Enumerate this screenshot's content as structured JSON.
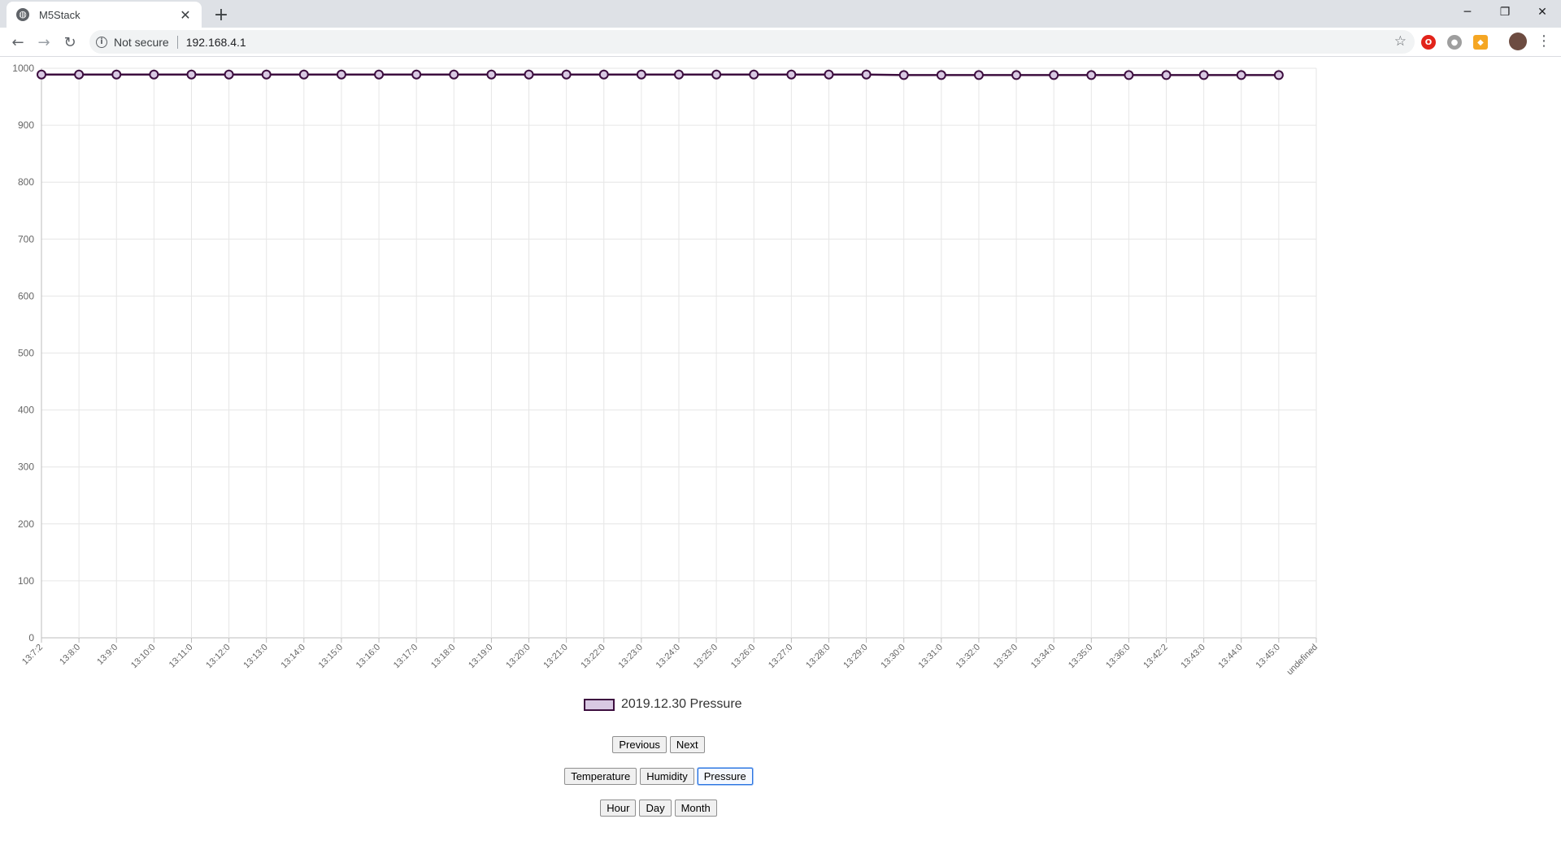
{
  "browser": {
    "tab_title": "M5Stack",
    "tab_close": "✕",
    "new_tab": "+",
    "security_label": "Not secure",
    "url": "192.168.4.1",
    "window_controls": {
      "minimize": "─",
      "restore": "❐",
      "close": "✕"
    }
  },
  "chart_data": {
    "type": "line",
    "categories": [
      "13:7:2",
      "13:8:0",
      "13:9:0",
      "13:10:0",
      "13:11:0",
      "13:12:0",
      "13:13:0",
      "13:14:0",
      "13:15:0",
      "13:16:0",
      "13:17:0",
      "13:18:0",
      "13:19:0",
      "13:20:0",
      "13:21:0",
      "13:22:0",
      "13:23:0",
      "13:24:0",
      "13:25:0",
      "13:26:0",
      "13:27:0",
      "13:28:0",
      "13:29:0",
      "13:30:0",
      "13:31:0",
      "13:32:0",
      "13:33:0",
      "13:34:0",
      "13:35:0",
      "13:36:0",
      "13:42:2",
      "13:43:0",
      "13:44:0",
      "13:45:0",
      "undefined"
    ],
    "series": [
      {
        "name": "2019.12.30 Pressure",
        "values": [
          989,
          989,
          989,
          989,
          989,
          989,
          989,
          989,
          989,
          989,
          989,
          989,
          989,
          989,
          989,
          989,
          989,
          989,
          989,
          989,
          989,
          989,
          989,
          988,
          988,
          988,
          988,
          988,
          988,
          988,
          988,
          988,
          988,
          988,
          null
        ],
        "line_color": "#3d0e3f",
        "fill_color": "#d9c9e3"
      }
    ],
    "ylim": [
      0,
      1000
    ],
    "yticks": [
      0,
      100,
      200,
      300,
      400,
      500,
      600,
      700,
      800,
      900,
      1000
    ],
    "grid": true,
    "legend": "bottom"
  },
  "controls": {
    "nav": [
      {
        "label": "Previous"
      },
      {
        "label": "Next"
      }
    ],
    "sensors": [
      {
        "label": "Temperature"
      },
      {
        "label": "Humidity"
      },
      {
        "label": "Pressure",
        "active": true
      }
    ],
    "ranges": [
      {
        "label": "Hour"
      },
      {
        "label": "Day"
      },
      {
        "label": "Month"
      }
    ]
  }
}
